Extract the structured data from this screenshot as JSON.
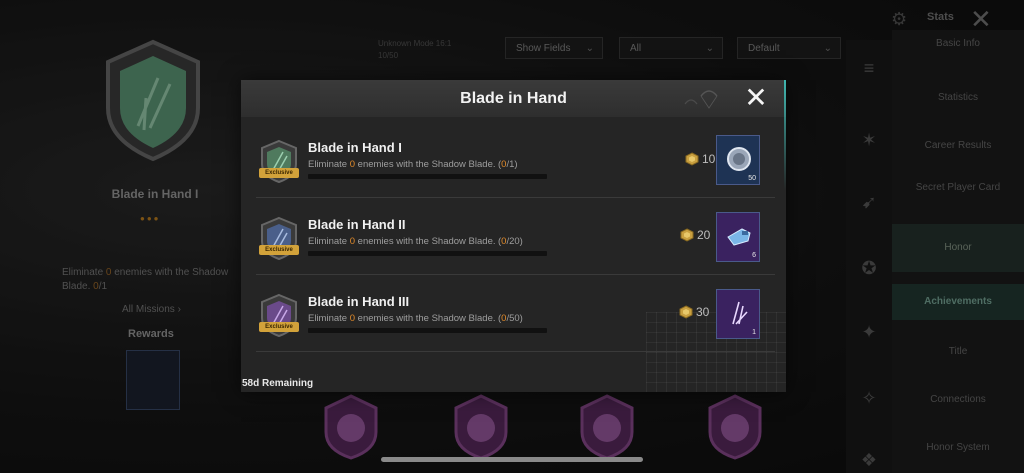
{
  "background": {
    "badge_title": "Blade in Hand I",
    "badge_dots": "●●●",
    "badge_desc_pre": "Eliminate ",
    "badge_desc_hl": "0",
    "badge_desc_post": " enemies with the Shadow Blade. ",
    "badge_desc_prog_hl": "0",
    "badge_desc_prog": "/1",
    "all_missions": "All Missions  ›",
    "rewards": "Rewards",
    "top_note_line1": "Unknown Mode 16:1",
    "top_note_line2": "10/50",
    "filters": [
      {
        "label": "Show Fields"
      },
      {
        "label": "All"
      },
      {
        "label": "Default"
      }
    ],
    "top_stats": "Stats",
    "sidebar_items": [
      {
        "label": "Basic Info"
      },
      {
        "label": "Statistics"
      },
      {
        "label": "Career Results"
      },
      {
        "label": "Secret Player Card"
      },
      {
        "label": "Honor"
      },
      {
        "label": "Achievements"
      },
      {
        "label": "Title"
      },
      {
        "label": "Connections"
      },
      {
        "label": "Honor System"
      }
    ]
  },
  "dialog": {
    "title": "Blade in Hand",
    "remaining": "58d Remaining",
    "exclusive_label": "Exclusive",
    "missions": [
      {
        "name": "Blade in Hand I",
        "desc_pre": "Eliminate ",
        "desc_count": "0",
        "desc_post": " enemies with the Shadow Blade.",
        "progress_open": "(",
        "progress_current": "0",
        "progress_total": "/1)",
        "progress_value": 0,
        "points": "10",
        "reward_count": "50",
        "badge_color": "#4f7a5e",
        "reward_bg": "#1e3354"
      },
      {
        "name": "Blade in Hand II",
        "desc_pre": "Eliminate ",
        "desc_count": "0",
        "desc_post": " enemies with the Shadow Blade.",
        "progress_open": "(",
        "progress_current": "0",
        "progress_total": "/20)",
        "progress_value": 0,
        "points": "20",
        "reward_count": "6",
        "badge_color": "#4a5f8a",
        "reward_bg": "#3a2260"
      },
      {
        "name": "Blade in Hand III",
        "desc_pre": "Eliminate ",
        "desc_count": "0",
        "desc_post": " enemies with the Shadow Blade.",
        "progress_open": "(",
        "progress_current": "0",
        "progress_total": "/50)",
        "progress_value": 0,
        "points": "30",
        "reward_count": "1",
        "badge_color": "#6a4a8a",
        "reward_bg": "#3a2260"
      }
    ]
  },
  "colors": {
    "accent_orange": "#e08a2a",
    "exclusive_gold": "#d2a23a",
    "sidebar_highlight": "#223a34"
  }
}
